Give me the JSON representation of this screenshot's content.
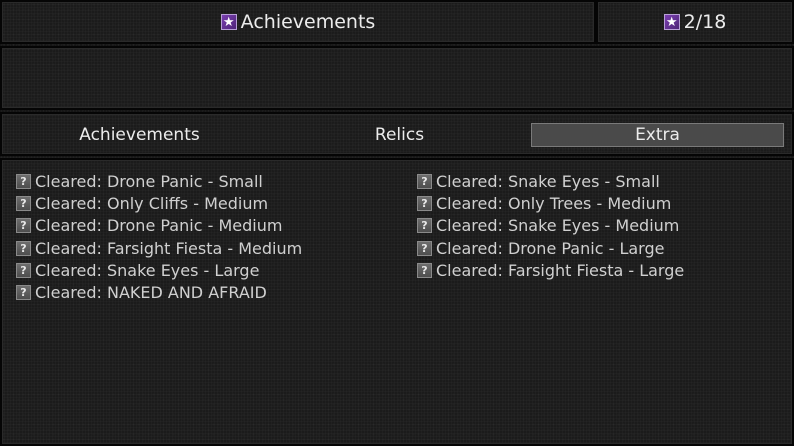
{
  "header": {
    "title": "Achievements",
    "count": "2/18",
    "icon": "star-icon",
    "icon_color": "#6a35a0"
  },
  "description": "",
  "tabs": [
    {
      "label": "Achievements",
      "active": false
    },
    {
      "label": "Relics",
      "active": false
    },
    {
      "label": "Extra",
      "active": true
    }
  ],
  "items_left": [
    "Cleared: Drone Panic - Small",
    "Cleared: Only Cliffs - Medium",
    "Cleared: Drone Panic - Medium",
    "Cleared: Farsight Fiesta - Medium",
    "Cleared: Snake Eyes - Large",
    "Cleared: NAKED AND AFRAID"
  ],
  "items_right": [
    "Cleared: Snake Eyes - Small",
    "Cleared: Only Trees - Medium",
    "Cleared: Snake Eyes - Medium",
    "Cleared: Drone Panic - Large",
    "Cleared: Farsight Fiesta - Large"
  ],
  "locked_icon_glyph": "?"
}
